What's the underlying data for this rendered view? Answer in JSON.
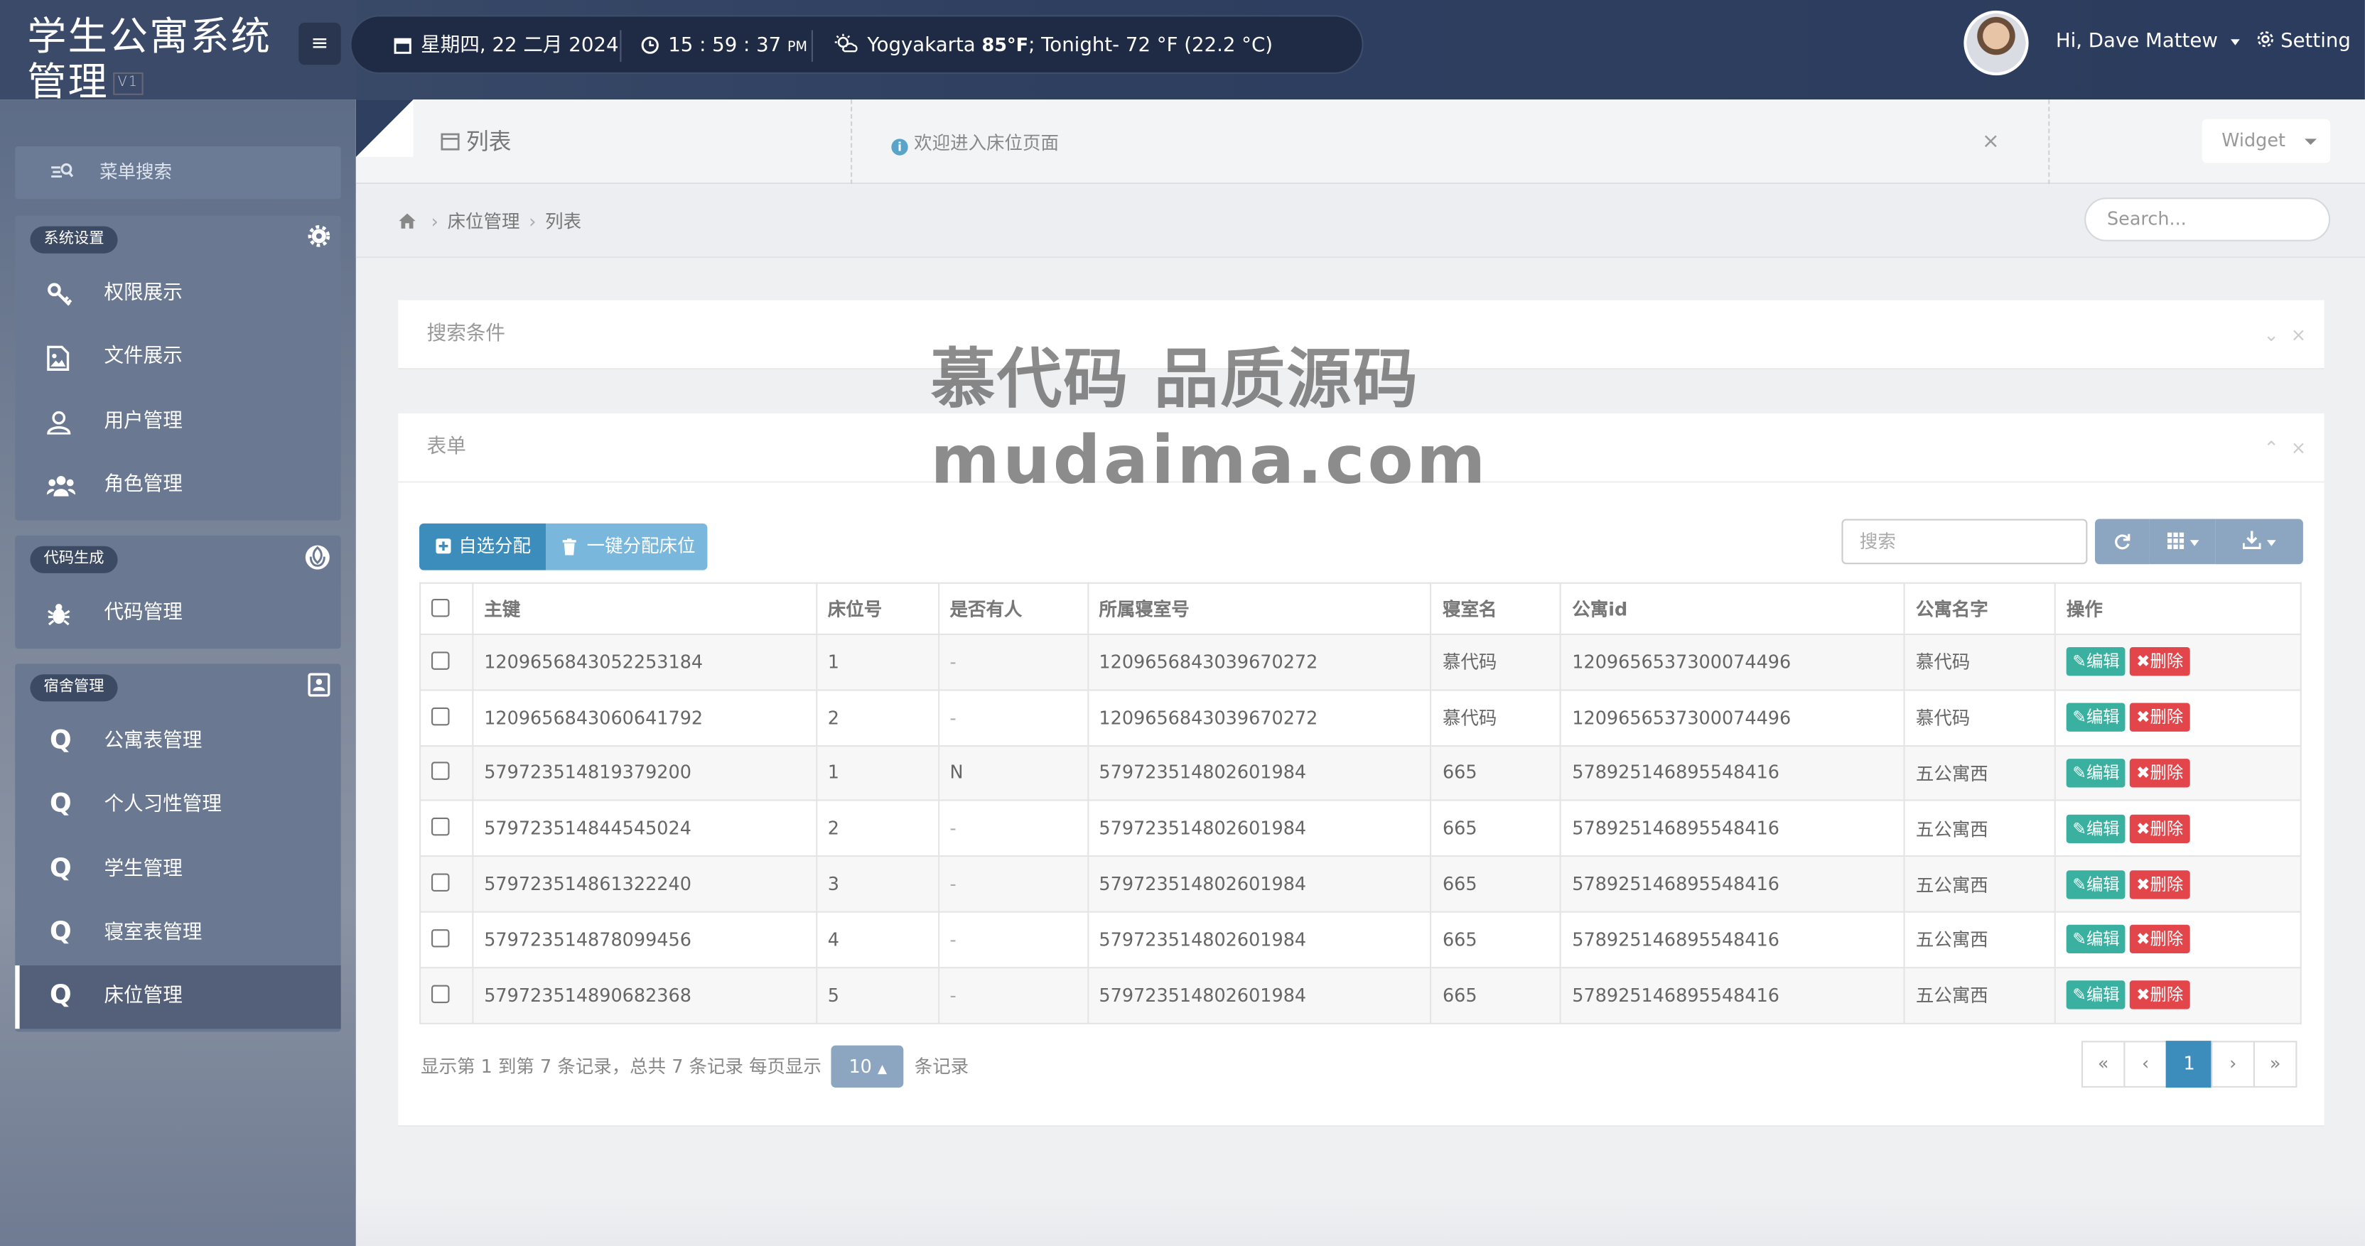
{
  "brand": {
    "title": "学生公寓系统管理",
    "version": "V1"
  },
  "topbar": {
    "date": "星期四, 22 二月 2024",
    "time": "15 : 59 : 37",
    "time_suffix": "PM",
    "weather_city": "Yogyakarta",
    "weather_temp": "85°F",
    "weather_tonight": "; Tonight- 72 °F (22.2 °C)",
    "user_greeting": "Hi, Dave Mattew",
    "setting_label": "Setting"
  },
  "sidebar": {
    "search_label": "菜单搜索",
    "groups": [
      {
        "badge": "系统设置",
        "icon": "gear-icon",
        "items": [
          {
            "label": "权限展示",
            "icon": "key-icon"
          },
          {
            "label": "文件展示",
            "icon": "image-file-icon"
          },
          {
            "label": "用户管理",
            "icon": "user-icon"
          },
          {
            "label": "角色管理",
            "icon": "users-icon"
          }
        ]
      },
      {
        "badge": "代码生成",
        "icon": "rebel-icon",
        "items": [
          {
            "label": "代码管理",
            "icon": "bug-icon"
          }
        ]
      },
      {
        "badge": "宿舍管理",
        "icon": "contact-card-icon",
        "items": [
          {
            "label": "公寓表管理",
            "icon": "q-icon"
          },
          {
            "label": "个人习性管理",
            "icon": "q-icon"
          },
          {
            "label": "学生管理",
            "icon": "q-icon"
          },
          {
            "label": "寝室表管理",
            "icon": "q-icon"
          },
          {
            "label": "床位管理",
            "icon": "q-icon",
            "active": true
          }
        ]
      }
    ]
  },
  "tabbar": {
    "tab_label": "列表",
    "welcome": "欢迎进入床位页面",
    "close": "×",
    "widget_label": "Widget"
  },
  "breadcrumb": {
    "home_icon": "home-icon",
    "items": [
      "床位管理",
      "列表"
    ],
    "search_placeholder": "Search..."
  },
  "search_panel": {
    "title": "搜索条件"
  },
  "table_panel": {
    "title": "表单",
    "btn_self_assign": "自选分配",
    "btn_auto_assign": "一键分配床位",
    "search_placeholder": "搜索",
    "columns": [
      "主键",
      "床位号",
      "是否有人",
      "所属寝室号",
      "寝室名",
      "公寓id",
      "公寓名字",
      "操作"
    ],
    "rows": [
      [
        "1209656843052253184",
        "1",
        "-",
        "1209656843039670272",
        "慕代码",
        "1209656537300074496",
        "慕代码"
      ],
      [
        "1209656843060641792",
        "2",
        "-",
        "1209656843039670272",
        "慕代码",
        "1209656537300074496",
        "慕代码"
      ],
      [
        "579723514819379200",
        "1",
        "N",
        "579723514802601984",
        "665",
        "578925146895548416",
        "五公寓西"
      ],
      [
        "579723514844545024",
        "2",
        "-",
        "579723514802601984",
        "665",
        "578925146895548416",
        "五公寓西"
      ],
      [
        "579723514861322240",
        "3",
        "-",
        "579723514802601984",
        "665",
        "578925146895548416",
        "五公寓西"
      ],
      [
        "579723514878099456",
        "4",
        "-",
        "579723514802601984",
        "665",
        "578925146895548416",
        "五公寓西"
      ],
      [
        "579723514890682368",
        "5",
        "-",
        "579723514802601984",
        "665",
        "578925146895548416",
        "五公寓西"
      ]
    ],
    "edit_label": "编辑",
    "delete_label": "删除",
    "pager_info_pre": "显示第 1 到第 7 条记录，总共 7 条记录 每页显示",
    "page_size": "10",
    "pager_info_post": "条记录",
    "pages": [
      "«",
      "‹",
      "1",
      "›",
      "»"
    ]
  },
  "watermark": {
    "line1": "慕代码 品质源码",
    "line2": "mudaima.com"
  },
  "colors": {
    "primary": "#3c8dbc",
    "edit": "#3ab0a0",
    "delete": "#e2464a",
    "topbar": "#2f3f60"
  }
}
